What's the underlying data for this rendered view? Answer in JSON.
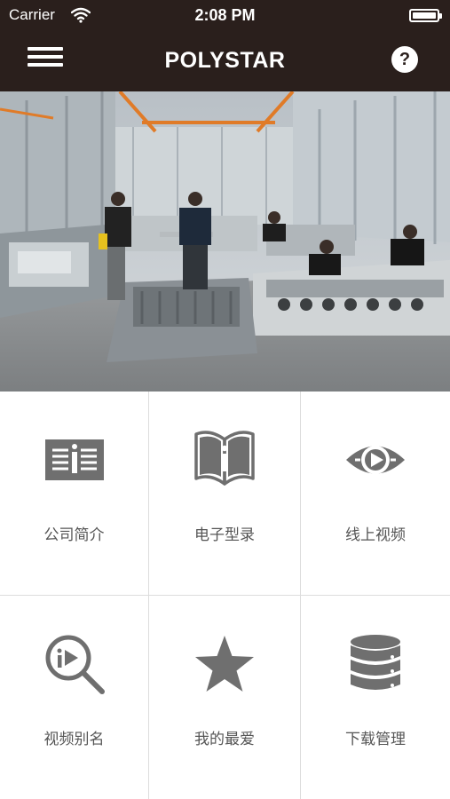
{
  "status_bar": {
    "carrier": "Carrier",
    "time": "2:08 PM"
  },
  "nav": {
    "title": "POLYSTAR",
    "help_symbol": "?"
  },
  "banner": {
    "slide_count": 1,
    "active_slide": 1
  },
  "grid": {
    "items": [
      {
        "label": "公司简介",
        "icon": "info-document-icon"
      },
      {
        "label": "电子型录",
        "icon": "open-book-icon"
      },
      {
        "label": "线上视频",
        "icon": "eye-play-icon"
      },
      {
        "label": "视频别名",
        "icon": "search-play-icon"
      },
      {
        "label": "我的最爱",
        "icon": "star-icon"
      },
      {
        "label": "下载管理",
        "icon": "database-icon"
      }
    ]
  },
  "colors": {
    "nav_background": "#2a1f1c",
    "icon_gray": "#6f6f6f",
    "label_gray": "#555555",
    "divider": "#dcdcdc"
  }
}
